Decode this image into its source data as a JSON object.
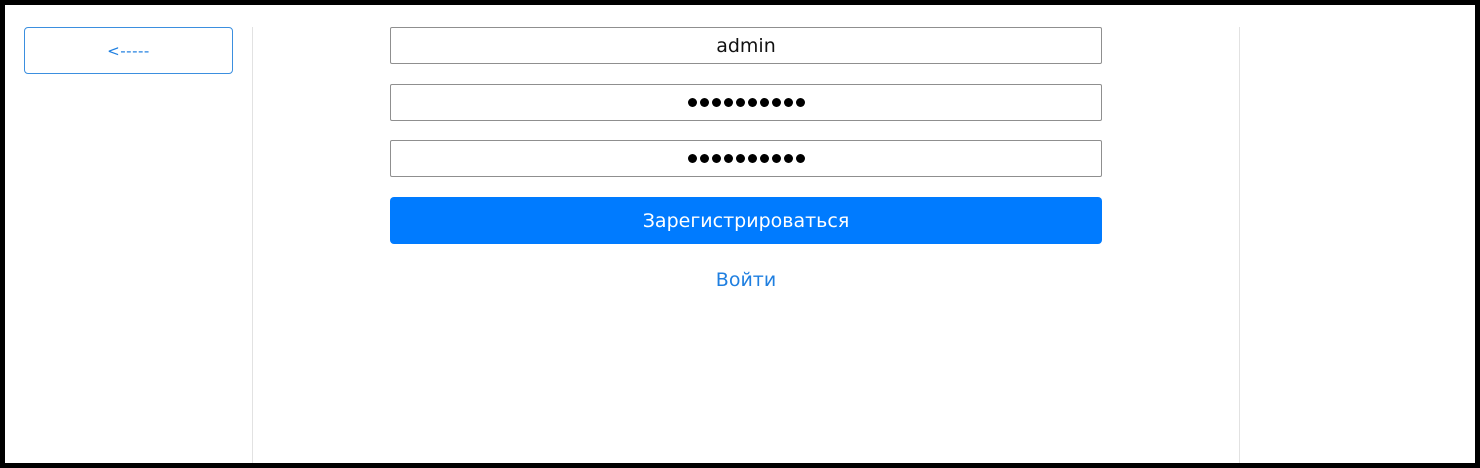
{
  "nav": {
    "back_label": "<-----"
  },
  "form": {
    "username_value": "admin",
    "password_mask_length": 10,
    "password_confirm_mask_length": 10,
    "register_label": "Зарегистрироваться",
    "login_link_label": "Войти"
  },
  "colors": {
    "primary": "#007bff",
    "link": "#1f7fe0",
    "frame_border": "#000000"
  }
}
